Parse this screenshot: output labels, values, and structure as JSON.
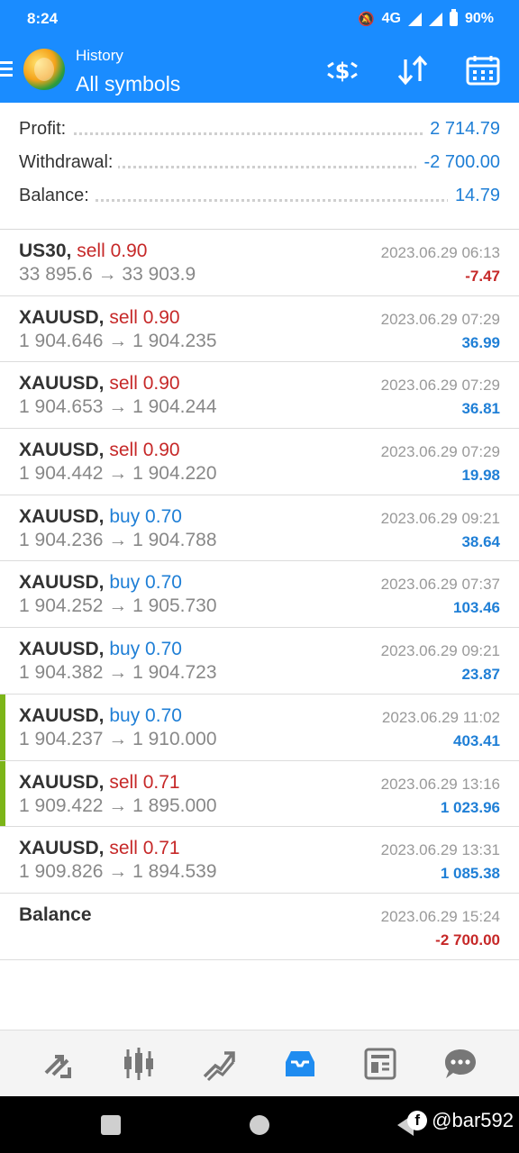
{
  "status_bar": {
    "time": "8:24",
    "network": "4G",
    "battery": "90%"
  },
  "app_bar": {
    "title": "History",
    "subtitle": "All symbols"
  },
  "summary": [
    {
      "label": "Profit:",
      "value": "2 714.79"
    },
    {
      "label": "Withdrawal:",
      "value": "-2 700.00"
    },
    {
      "label": "Balance:",
      "value": "14.79"
    }
  ],
  "deals": [
    {
      "symbol": "US30,",
      "side": "sell 0.90",
      "prices": "33 895.6 → 33 903.9",
      "date": "2023.06.29 06:13",
      "profit": "-7.47"
    },
    {
      "symbol": "XAUUSD,",
      "side": "sell 0.90",
      "prices": "1 904.646 → 1 904.235",
      "date": "2023.06.29 07:29",
      "profit": "36.99"
    },
    {
      "symbol": "XAUUSD,",
      "side": "sell 0.90",
      "prices": "1 904.653 → 1 904.244",
      "date": "2023.06.29 07:29",
      "profit": "36.81"
    },
    {
      "symbol": "XAUUSD,",
      "side": "sell 0.90",
      "prices": "1 904.442 → 1 904.220",
      "date": "2023.06.29 07:29",
      "profit": "19.98"
    },
    {
      "symbol": "XAUUSD,",
      "side": "buy 0.70",
      "prices": "1 904.236 → 1 904.788",
      "date": "2023.06.29 09:21",
      "profit": "38.64"
    },
    {
      "symbol": "XAUUSD,",
      "side": "buy 0.70",
      "prices": "1 904.252 → 1 905.730",
      "date": "2023.06.29 07:37",
      "profit": "103.46"
    },
    {
      "symbol": "XAUUSD,",
      "side": "buy 0.70",
      "prices": "1 904.382 → 1 904.723",
      "date": "2023.06.29 09:21",
      "profit": "23.87"
    },
    {
      "symbol": "XAUUSD,",
      "side": "buy 0.70",
      "prices": "1 904.237 → 1 910.000",
      "date": "2023.06.29 11:02",
      "profit": "403.41"
    },
    {
      "symbol": "XAUUSD,",
      "side": "sell 0.71",
      "prices": "1 909.422 → 1 895.000",
      "date": "2023.06.29 13:16",
      "profit": "1 023.96"
    },
    {
      "symbol": "XAUUSD,",
      "side": "sell 0.71",
      "prices": "1 909.826 → 1 894.539",
      "date": "2023.06.29 13:31",
      "profit": "1 085.38"
    },
    {
      "symbol": "Balance",
      "side": "",
      "prices": "",
      "date": "2023.06.29 15:24",
      "profit": "-2 700.00"
    }
  ],
  "bottom_nav": [
    "quotes-icon",
    "chart-icon",
    "trade-icon",
    "history-icon",
    "news-icon",
    "messages-icon"
  ],
  "watermark": "@bar592",
  "colors": {
    "accent": "#1a8cff",
    "sell": "#c62828",
    "buy": "#1f7fd6",
    "marker": "#7cb518"
  }
}
